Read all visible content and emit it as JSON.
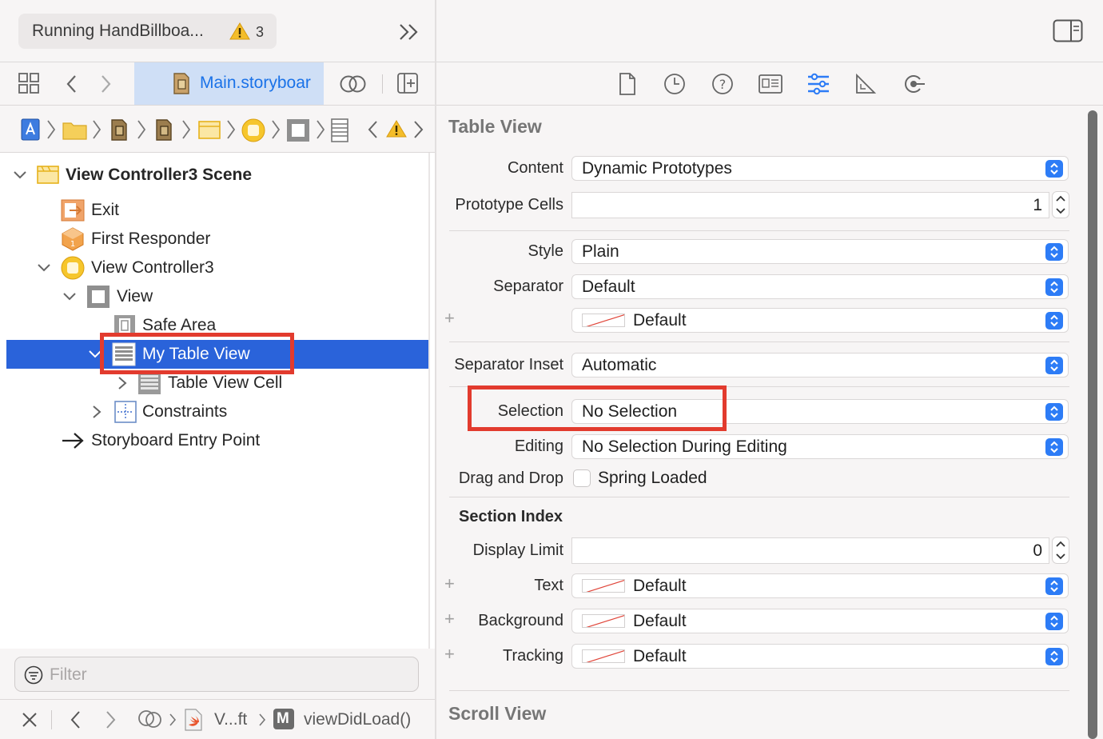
{
  "toolbar": {
    "status": "Running HandBillboa...",
    "warning_count": "3",
    "editor_tab": "Main.storyboar"
  },
  "outline": {
    "scene": "View Controller3 Scene",
    "items": [
      {
        "label": "Exit"
      },
      {
        "label": "First Responder"
      },
      {
        "label": "View Controller3"
      },
      {
        "label": "View"
      },
      {
        "label": "Safe Area"
      },
      {
        "label": "My Table View"
      },
      {
        "label": "Table View Cell"
      },
      {
        "label": "Constraints"
      },
      {
        "label": "Storyboard Entry Point"
      }
    ],
    "filter_placeholder": "Filter"
  },
  "jumpbar_bottom": {
    "file": "V...ft",
    "method_badge": "M",
    "method": "viewDidLoad()"
  },
  "inspector": {
    "table_view_title": "Table View",
    "content_label": "Content",
    "content_value": "Dynamic Prototypes",
    "prototype_cells_label": "Prototype Cells",
    "prototype_cells_value": "1",
    "style_label": "Style",
    "style_value": "Plain",
    "separator_label": "Separator",
    "separator_value": "Default",
    "separator_color_value": "Default",
    "separator_inset_label": "Separator Inset",
    "separator_inset_value": "Automatic",
    "selection_label": "Selection",
    "selection_value": "No Selection",
    "editing_label": "Editing",
    "editing_value": "No Selection During Editing",
    "drag_drop_label": "Drag and Drop",
    "spring_loaded_label": "Spring Loaded",
    "section_index_title": "Section Index",
    "display_limit_label": "Display Limit",
    "display_limit_value": "0",
    "text_label": "Text",
    "text_value": "Default",
    "background_label": "Background",
    "background_value": "Default",
    "tracking_label": "Tracking",
    "tracking_value": "Default",
    "scroll_view_title": "Scroll View"
  },
  "colors": {
    "selection": "#2a63da",
    "accent": "#2d7cf6",
    "highlight": "#e23b2e"
  }
}
